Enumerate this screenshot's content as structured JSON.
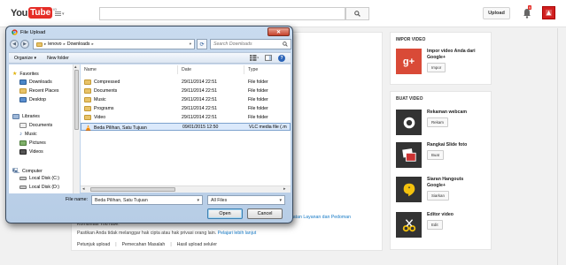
{
  "masthead": {
    "logo_you": "You",
    "logo_tube": "Tube",
    "logo_sup": "ID",
    "upload_label": "Upload",
    "notif_count": "9",
    "search_placeholder": ""
  },
  "main": {
    "lines": [
      {
        "text": "syaratan Layanan dan Pedoman",
        "link": true
      },
      {
        "text": "Komunitas YouTube.",
        "link": false
      },
      {
        "text": "Pastikan Anda tidak melanggar hak cipta atau hak privasi orang lain.",
        "link": false
      },
      {
        "text": "Pelajari lebih lanjut",
        "link": true
      }
    ],
    "help_links": [
      "Petunjuk upload",
      "Pemecahan Masalah",
      "Hasil upload seluler"
    ]
  },
  "sidebar": {
    "import_title": "IMPOR VIDEO",
    "import_item": {
      "label": "Impor video Anda dari Google+",
      "button": "Impor",
      "icon": "google-plus-icon"
    },
    "create_title": "BUAT VIDEO",
    "create_items": [
      {
        "label": "Rekaman webcam",
        "button": "Rekam",
        "icon": "webcam-icon"
      },
      {
        "label": "Rangkai Slide foto",
        "button": "Buat",
        "icon": "photo-slideshow-icon"
      },
      {
        "label": "Siaran Hangouts Google+",
        "button": "Siarkan",
        "icon": "hangouts-icon"
      },
      {
        "label": "Editor video",
        "button": "Edit",
        "icon": "scissors-icon"
      }
    ]
  },
  "dialog": {
    "title": "File Upload",
    "close_glyph": "✕",
    "breadcrumb": [
      "lenovo",
      "Downloads"
    ],
    "search_placeholder": "Search Downloads",
    "toolbar": {
      "organize": "Organize ▾",
      "new_folder": "New folder"
    },
    "nav": {
      "favorites": "Favorites",
      "fav_items": [
        "Downloads",
        "Recent Places",
        "Desktop"
      ],
      "libraries": "Libraries",
      "lib_items": [
        "Documents",
        "Music",
        "Pictures",
        "Videos"
      ],
      "computer": "Computer",
      "comp_items": [
        "Local Disk (C:)",
        "Local Disk (D:)"
      ]
    },
    "columns": [
      "Name",
      "Date",
      "Type"
    ],
    "files": [
      {
        "name": "Compressed",
        "date": "29/11/2014 22:51",
        "type": "File folder",
        "icon": "folder-icon"
      },
      {
        "name": "Documents",
        "date": "29/11/2014 22:51",
        "type": "File folder",
        "icon": "folder-icon"
      },
      {
        "name": "Music",
        "date": "29/11/2014 22:51",
        "type": "File folder",
        "icon": "folder-icon"
      },
      {
        "name": "Programs",
        "date": "29/11/2014 22:51",
        "type": "File folder",
        "icon": "folder-icon"
      },
      {
        "name": "Video",
        "date": "29/11/2014 22:51",
        "type": "File folder",
        "icon": "folder-icon"
      },
      {
        "name": "Beda Pilihan, Satu Tujuan",
        "date": "09/01/2015 12:50",
        "type": "VLC media file (.m",
        "icon": "vlc-file-icon",
        "selected": true
      }
    ],
    "filename_label": "File name:",
    "filename_value": "Beda Pilihan, Satu Tujuan",
    "filter_value": "All Files",
    "open_label": "Open",
    "cancel_label": "Cancel"
  },
  "colors": {
    "brand_red": "#e52d27",
    "link_blue": "#167ac6",
    "selection": "#dbe9fb"
  }
}
